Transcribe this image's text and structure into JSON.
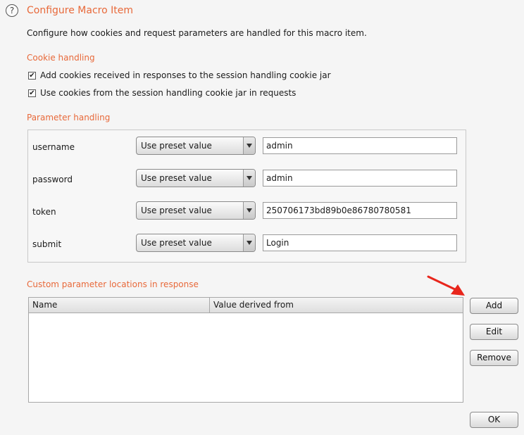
{
  "dialog": {
    "title": "Configure Macro Item",
    "description": "Configure how cookies and request parameters are handled for this macro item.",
    "help_icon": "?"
  },
  "cookie_handling": {
    "title": "Cookie handling",
    "options": [
      {
        "label": "Add cookies received in responses to the session handling cookie jar",
        "checked": true
      },
      {
        "label": "Use cookies from the session handling cookie jar in requests",
        "checked": true
      }
    ]
  },
  "parameter_handling": {
    "title": "Parameter handling",
    "rows": [
      {
        "name": "username",
        "mode": "Use preset value",
        "value": "admin"
      },
      {
        "name": "password",
        "mode": "Use preset value",
        "value": "admin"
      },
      {
        "name": "token",
        "mode": "Use preset value",
        "value": "250706173bd89b0e86780780581"
      },
      {
        "name": "submit",
        "mode": "Use preset value",
        "value": "Login"
      }
    ]
  },
  "custom_locations": {
    "title": "Custom parameter locations in response",
    "columns": [
      "Name",
      "Value derived from"
    ],
    "rows": []
  },
  "buttons": {
    "add": "Add",
    "edit": "Edit",
    "remove": "Remove",
    "ok": "OK"
  },
  "annotation": {
    "arrow_color": "#e8261c"
  },
  "icons": {
    "checkmark": "check-icon",
    "dropdown": "chevron-down-icon"
  }
}
